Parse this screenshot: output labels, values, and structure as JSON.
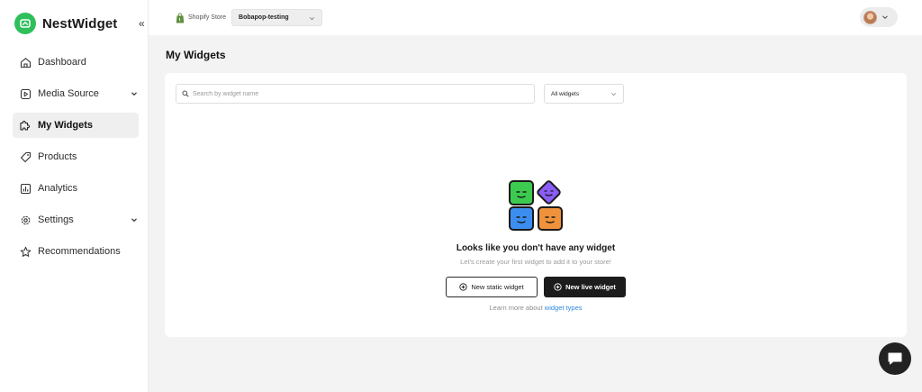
{
  "app": {
    "name": "NestWidget",
    "brand_color": "#2fbf5a"
  },
  "sidebar": {
    "collapse_label": "«",
    "items": [
      {
        "label": "Dashboard",
        "icon": "home-icon",
        "active": false,
        "expandable": false
      },
      {
        "label": "Media Source",
        "icon": "media-source-icon",
        "active": false,
        "expandable": true
      },
      {
        "label": "My Widgets",
        "icon": "puzzle-icon",
        "active": true,
        "expandable": false
      },
      {
        "label": "Products",
        "icon": "tag-icon",
        "active": false,
        "expandable": false
      },
      {
        "label": "Analytics",
        "icon": "analytics-icon",
        "active": false,
        "expandable": false
      },
      {
        "label": "Settings",
        "icon": "gear-icon",
        "active": false,
        "expandable": true
      },
      {
        "label": "Recommendations",
        "icon": "star-icon",
        "active": false,
        "expandable": false
      }
    ]
  },
  "topbar": {
    "store_label": "Shopify Store",
    "store_value": "Bobapop-testing"
  },
  "main": {
    "title": "My Widgets",
    "search": {
      "placeholder": "Search by widget name",
      "value": ""
    },
    "filter": {
      "value": "All widgets"
    },
    "empty_state": {
      "title": "Looks like you don't have any widget",
      "subtitle": "Let's create your first widget to add it to your store!",
      "static_button": "New static widget",
      "live_button": "New live widget",
      "learn_prefix": "Learn more about",
      "learn_link": "widget types",
      "face_colors": [
        "#3ccb50",
        "#8b5cf6",
        "#3b8ef0",
        "#f0923b"
      ]
    }
  },
  "colors": {
    "link": "#2d8be0",
    "primary_button": "#1c1c1c"
  }
}
